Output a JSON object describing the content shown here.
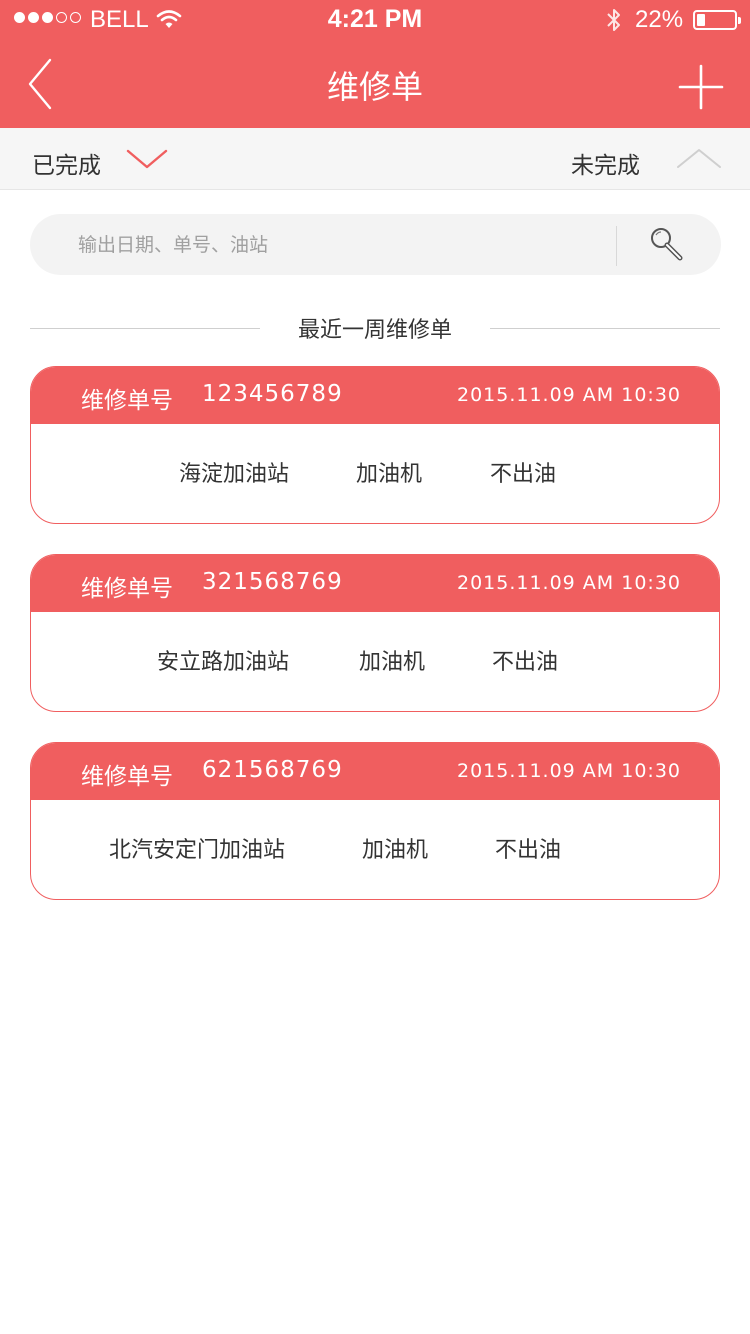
{
  "status_bar": {
    "carrier": "BELL",
    "time": "4:21 PM",
    "battery_percent": "22%",
    "battery_level": 0.22,
    "signal_full": 3,
    "signal_total": 5
  },
  "nav": {
    "title": "维修单",
    "back_icon": "chevron-left-icon",
    "add_icon": "plus-icon"
  },
  "filter": {
    "done_label": "已完成",
    "undone_label": "未完成"
  },
  "search": {
    "placeholder": "输出日期、单号、油站",
    "icon": "search-icon"
  },
  "section": {
    "title": "最近一周维修单"
  },
  "orders": [
    {
      "label": "维修单号",
      "number": "123456789",
      "date": "2015.11.09  AM  10:30",
      "station": "海淀加油站",
      "device": "加油机",
      "issue": "不出油"
    },
    {
      "label": "维修单号",
      "number": "321568769",
      "date": "2015.11.09  AM  10:30",
      "station": "安立路加油站",
      "device": "加油机",
      "issue": "不出油"
    },
    {
      "label": "维修单号",
      "number": "621568769",
      "date": "2015.11.09  AM  10:30",
      "station": "北汽安定门加油站",
      "device": "加油机",
      "issue": "不出油"
    }
  ],
  "colors": {
    "accent": "#f05e5f",
    "filter_bg": "#f6f6f6",
    "search_bg": "#f3f3f3"
  }
}
